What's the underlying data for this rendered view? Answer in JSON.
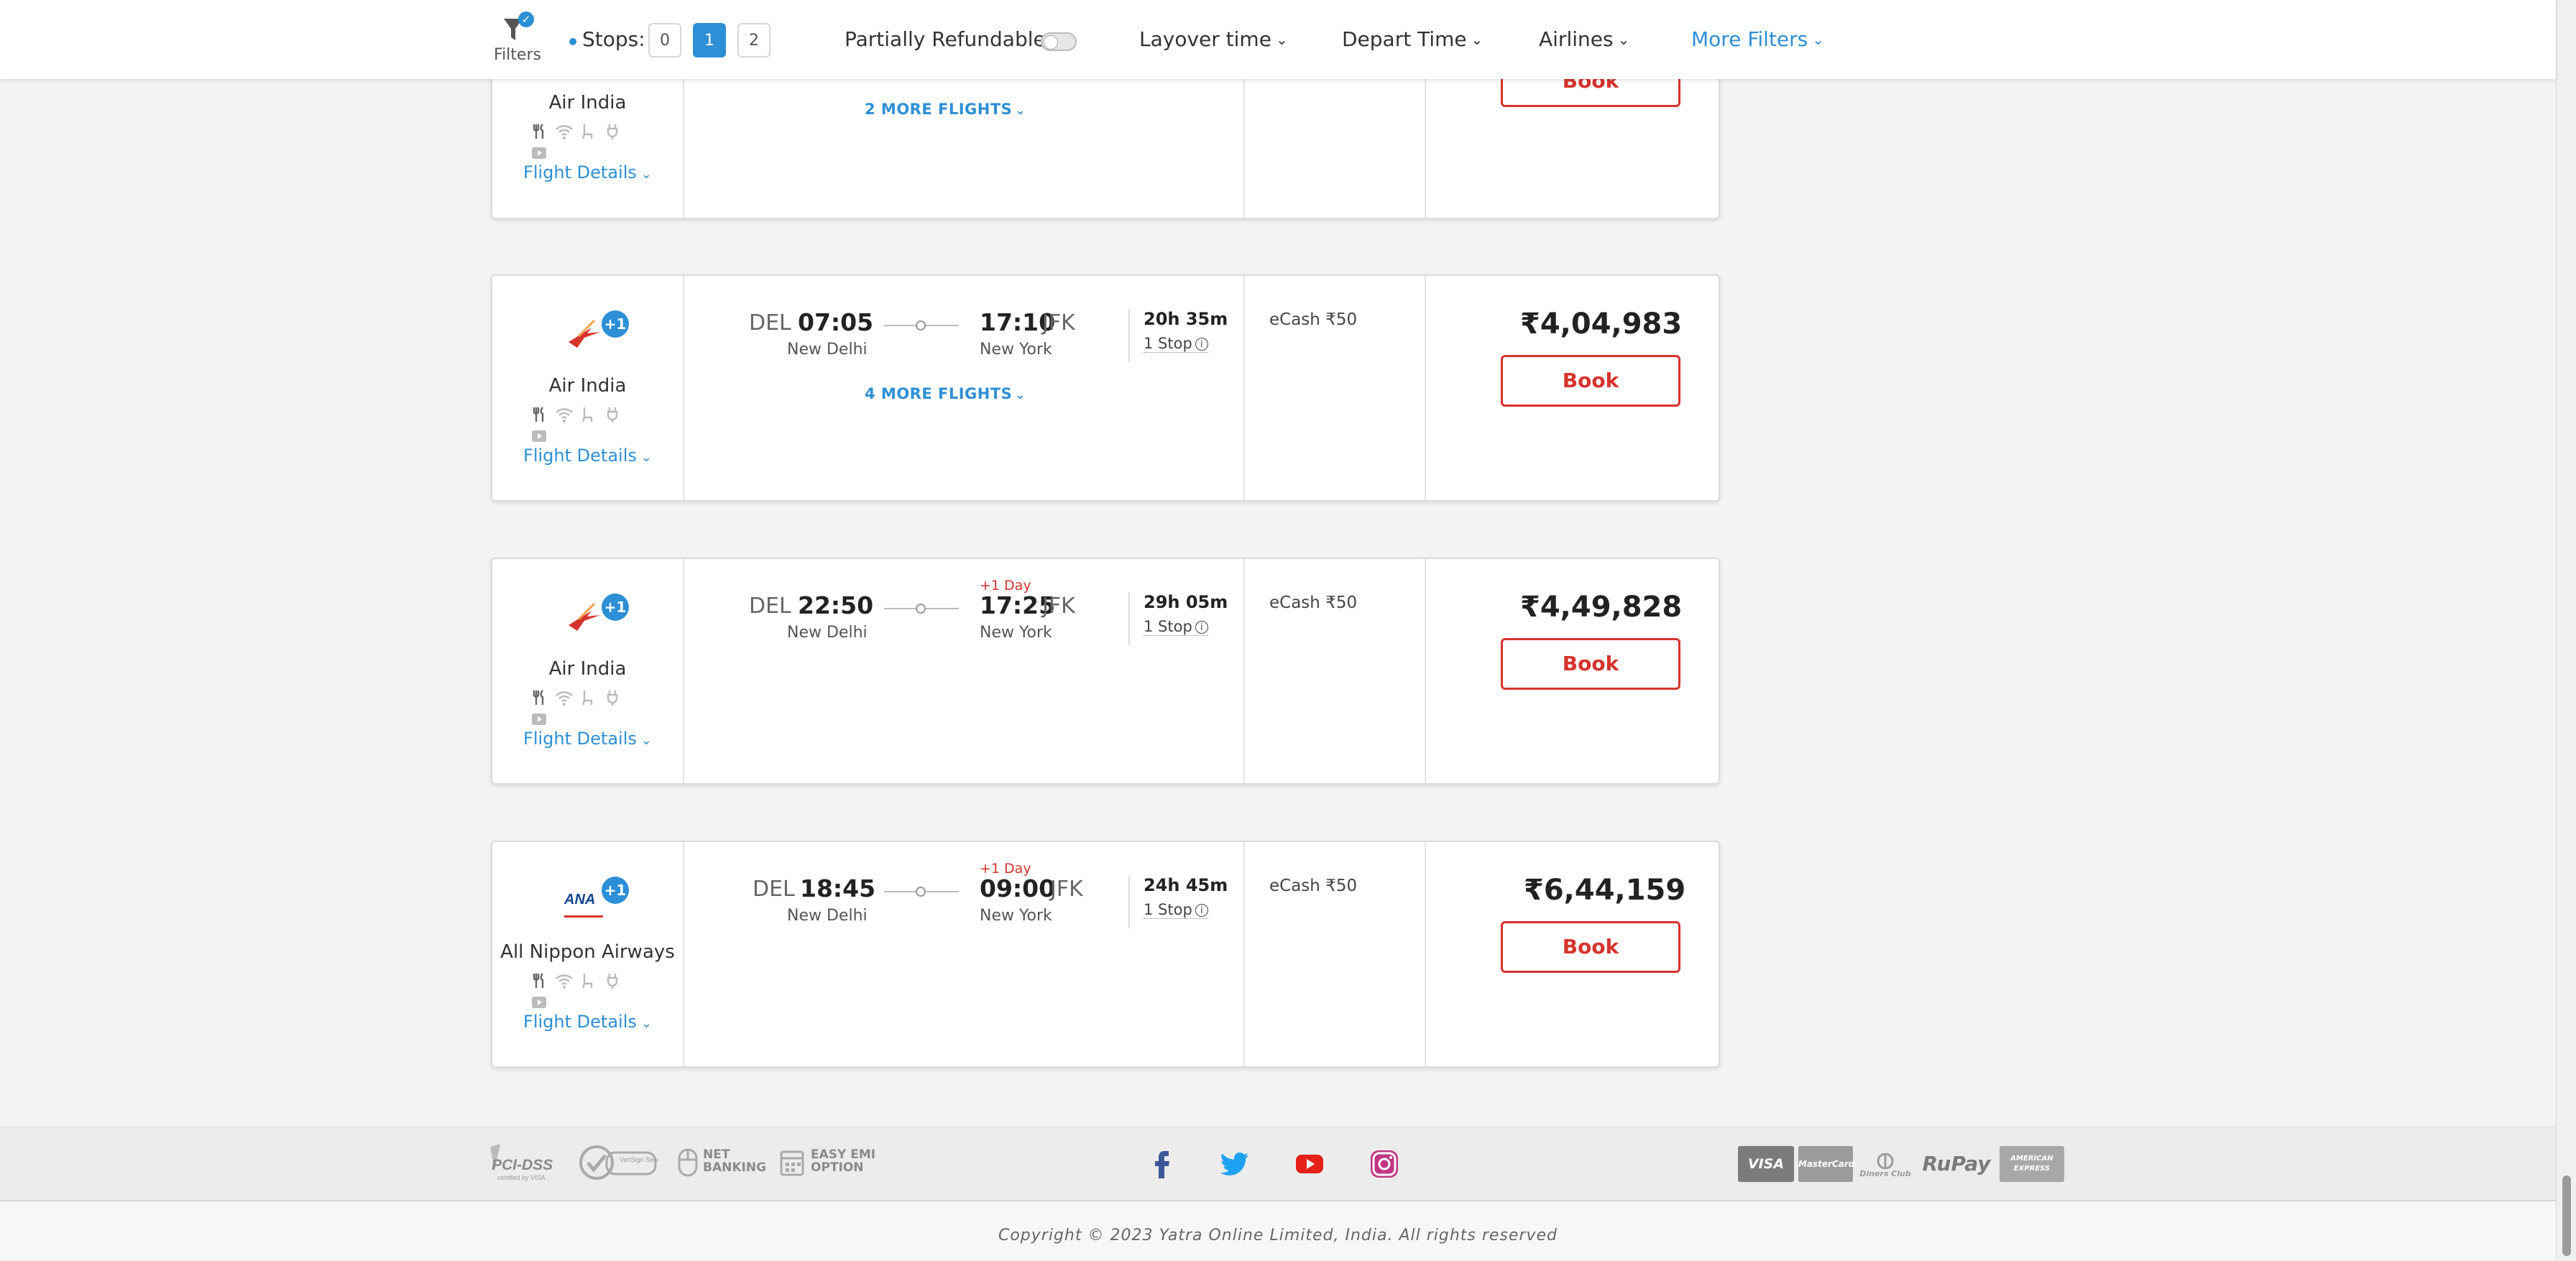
{
  "filter_bar": {
    "filters_label": "Filters",
    "filters_badge": "✓",
    "stops_label": "Stops:",
    "stops_options": [
      "0",
      "1",
      "2"
    ],
    "stops_selected": "1",
    "partially_refundable": "Partially Refundable",
    "layover_time": "Layover time",
    "depart_time": "Depart Time",
    "airlines": "Airlines",
    "more_filters": "More Filters"
  },
  "book_label": "Book",
  "flight_details_label": "Flight Details",
  "cards": [
    {
      "airline": "Air India",
      "more_flights": "2 MORE FLIGHTS"
    },
    {
      "airline": "Air India",
      "badge": "+1",
      "from_code": "DEL",
      "depart": "07:05",
      "from_city": "New Delhi",
      "to_code": "JFK",
      "arrive": "17:10",
      "to_city": "New York",
      "duration": "20h 35m",
      "stops": "1 Stop",
      "ecash_label": "eCash",
      "ecash": "₹50",
      "price": "₹4,04,983",
      "more_flights": "4 MORE FLIGHTS"
    },
    {
      "airline": "Air India",
      "badge": "+1",
      "from_code": "DEL",
      "depart": "22:50",
      "from_city": "New Delhi",
      "plus_day": "+1 Day",
      "to_code": "JFK",
      "arrive": "17:25",
      "to_city": "New York",
      "duration": "29h 05m",
      "stops": "1 Stop",
      "ecash_label": "eCash",
      "ecash": "₹50",
      "price": "₹4,49,828"
    },
    {
      "airline": "All Nippon Airways",
      "badge": "+1",
      "from_code": "DEL",
      "depart": "18:45",
      "from_city": "New Delhi",
      "plus_day": "+1 Day",
      "to_code": "JFK",
      "arrive": "09:00",
      "to_city": "New York",
      "duration": "24h 45m",
      "stops": "1 Stop",
      "ecash_label": "eCash",
      "ecash": "₹50",
      "price": "₹6,44,159"
    }
  ],
  "footer": {
    "badges": [
      "PCI-DSS",
      "NET BANKING",
      "EASY EMI OPTION"
    ],
    "pci_sub": "certified by VISA",
    "verisign": "VeriSign Secured",
    "social": [
      "facebook-icon",
      "twitter-icon",
      "youtube-icon",
      "instagram-icon"
    ],
    "payments": [
      "VISA",
      "MasterCard",
      "Diners Club",
      "RuPay",
      "AMERICAN EXPRESS"
    ],
    "copyright": "Copyright © 2023 Yatra Online Limited, India. All rights reserved"
  },
  "colors": {
    "accent": "#2d8fd6",
    "book_red": "#d6332d"
  }
}
